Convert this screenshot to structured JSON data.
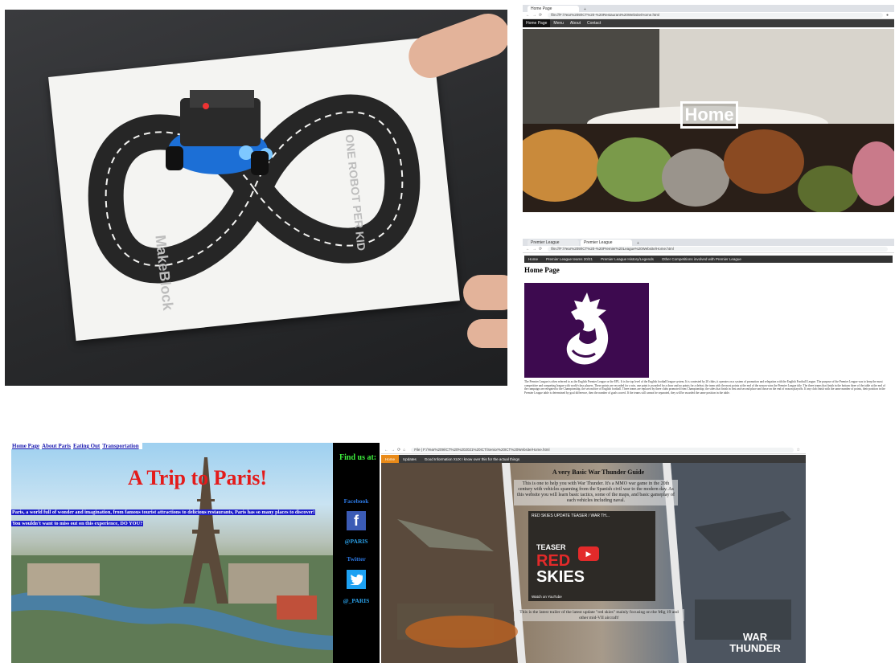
{
  "colors": {
    "paris_title": "#e31b1b",
    "paris_find_us": "#3ef03e",
    "paris_social": "#2d7be8",
    "premier_purple": "#3d0a4f",
    "thunder_active_tab": "#e98a18",
    "restaurant_nav": "#3b3b3b"
  },
  "robot_photo": {
    "mat_brand_text": "MakeBlock",
    "mat_slogan_text": "ONE ROBOT PER KID"
  },
  "restaurant_site": {
    "tab_title": "Home Page",
    "url": "file:///F:/Year%209/ICT%20-%20Restaurant%20Website/Home.html",
    "nav": [
      "Home Page",
      "Menu",
      "About",
      "Contact"
    ],
    "hero_title": "Home"
  },
  "premier_site": {
    "tabs": [
      "Premier League",
      "Premier League"
    ],
    "url": "file:///F:/Year%209/ICT%20-%20Premier%20League%20Website/Home.html",
    "nav": [
      "Home",
      "Premier League teams 20/21",
      "Premier League History/Legends",
      "Other Competitions involved with Premier League"
    ],
    "heading": "Home Page",
    "body": "The Premier League is often referred to as the English Premier League or the EPL. It is the top level of the English football league system. It is contested by 20 clubs, it operates on a system of promotion and relegation with the English Football League. The purpose of the Premier League was to keep the most competitive and competing league with world-class players. These points are recorded for a win, one point is awarded for a draw and no points for a defeat, the team with the most points at the end of the season wins the Premier League title. The three teams that finish in the bottom three of the table at the end of the campaign are relegated to the Championship, the second tier of English football. Three teams are replaced by three clubs promoted from Championship; the sides that finish in first and second place and those on the end of season playoffs. If any club finish with the same number of points, their position in the Premier League table is determined by goal difference, then the number of goals scored. If the teams still cannot be separated, they will be awarded the same position in the table."
  },
  "paris_site": {
    "nav": [
      "Home Page",
      "About Paris",
      "Eating Out",
      "Transportation"
    ],
    "title": "A Trip to Paris!",
    "tagline_1": "Paris, a world full of wonder and imagination, from famous tourist attractions to delicious restaurants, Paris has so many places to discover!",
    "tagline_2": "You wouldn't want to miss out on this experience, DO YOU?",
    "find_us": "Find us at:",
    "facebook_label": "Facebook",
    "facebook_handle": "@PARIS",
    "twitter_label": "Twitter",
    "twitter_handle": "@_PARIS"
  },
  "thunder_site": {
    "url": "File | F:/Year%209/ICT%20%202021%20ICT/Senior%20ICT%20Website/Home.html",
    "nav": [
      "Home",
      "Updates",
      "Good Information XUX I know over this for the actual things"
    ],
    "guide_title": "A very Basic War Thunder Guide",
    "guide_text": "This is one to help you with War Thunder. It's a MMO war game in the 20th century with vehicles spanning from the Spanish civil war to the modern day. As this website you will learn basic tactics, some of the maps, and basic gameplay of each vehicles including naval.",
    "video_title": "RED SKIES UPDATE TEASER / WAR TH...",
    "video_teaser": "TEASER",
    "video_red": "RED",
    "video_skies": "SKIES",
    "video_watch": "Watch on YouTube",
    "caption": "This is the latest trailer of the latest update \"red skies\" mainly focusing on the Mig 19 and other mid-VII aircraft!",
    "brand": "WAR THUNDER"
  }
}
